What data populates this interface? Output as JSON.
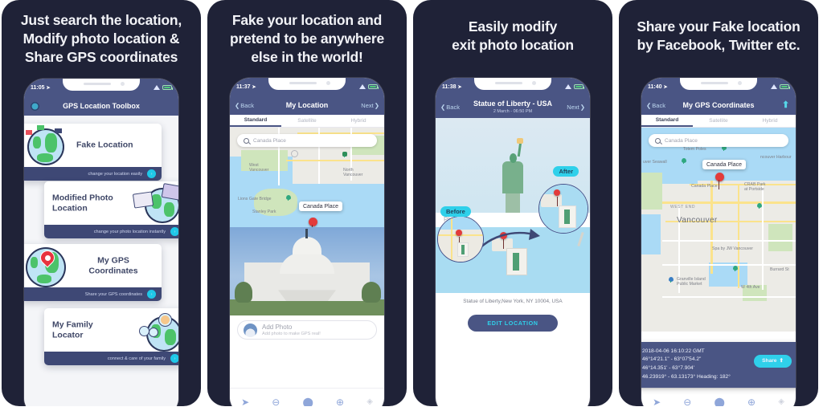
{
  "panels": [
    {
      "headline": "Just search the location,\nModify photo location &\nShare GPS coordinates",
      "phone": {
        "time": "11:05",
        "nav_title": "GPS Location Toolbox",
        "gear_icon": "gear-icon",
        "features": [
          {
            "title": "Fake Location",
            "caption": "change your location easily",
            "chevron": "›"
          },
          {
            "title": "Modified Photo\nLocation",
            "caption": "change your photo location instantly",
            "chevron": "›"
          },
          {
            "title": "My GPS\nCoordinates",
            "caption": "Share your GPS coordinates",
            "chevron": "›"
          },
          {
            "title": "My Family\nLocator",
            "caption": "connect & care of your family",
            "chevron": "›"
          }
        ]
      }
    },
    {
      "headline": "Fake your location and\npretend to be anywhere\nelse in the world!",
      "phone": {
        "time": "11:37",
        "back_label": "Back",
        "nav_title": "My Location",
        "next_label": "Next",
        "tabs": [
          "Standard",
          "Satellite",
          "Hybrid"
        ],
        "active_tab": "Standard",
        "search_value": "Canada Place",
        "map_labels": [
          "West\nVancouver",
          "North\nVancouver",
          "Lions Gate Bridge",
          "Stanley Park"
        ],
        "callout": "Canada Place",
        "add_photo_title": "Add Photo",
        "add_photo_sub": "Add photo to make GPS real!",
        "tabbar": [
          "navigate-icon",
          "zoom-out-icon",
          "location-pin-icon",
          "zoom-in-icon",
          "target-icon"
        ]
      }
    },
    {
      "headline": "Easily modify\nexit photo location",
      "phone": {
        "time": "11:38",
        "back_label": "Back",
        "nav_title": "Statue of Liberty - USA",
        "nav_subtitle": "2 March - 06:50 PM",
        "next_label": "Next",
        "badge_before": "Before",
        "badge_after": "After",
        "places_label": "Places",
        "caption": "Statue of Liberty,New York, NY 10004, USA",
        "edit_button": "EDIT LOCATION"
      }
    },
    {
      "headline": "Share your Fake location\nby Facebook, Twitter etc.",
      "phone": {
        "time": "11:40",
        "back_label": "Back",
        "nav_title": "My GPS Coordinates",
        "share_icon": "share-icon",
        "tabs": [
          "Standard",
          "Satellite",
          "Hybrid"
        ],
        "active_tab": "Standard",
        "search_value": "Canada Place",
        "callout": "Canada Place",
        "map_labels": [
          "Totem Poles",
          "uver Seawall",
          "ncouver Harbour",
          "Canada Place",
          "CRAB Park\nat Portside",
          "WEST END",
          "Vancouver",
          "Spa by JW Vancouver",
          "Granville Island\nPublic Market"
        ],
        "gps_lines": [
          "2018-04-06    16:10:22 GMT",
          "46°14'21.1\" - 63°07'54.2\"",
          "46°14.351' - 63°7.904'",
          "46.23919° - 63.13173°    Heading: 182°"
        ],
        "share_button": "Share",
        "tabbar": [
          "navigate-icon",
          "zoom-out-icon",
          "location-pin-icon",
          "zoom-in-icon",
          "target-icon"
        ]
      }
    }
  ],
  "colors": {
    "panel_bg": "#1f2237",
    "navy": "#4a5584",
    "accent_cyan": "#2fd0ea",
    "pin_red": "#e23b3b",
    "water": "#aadaf6"
  }
}
